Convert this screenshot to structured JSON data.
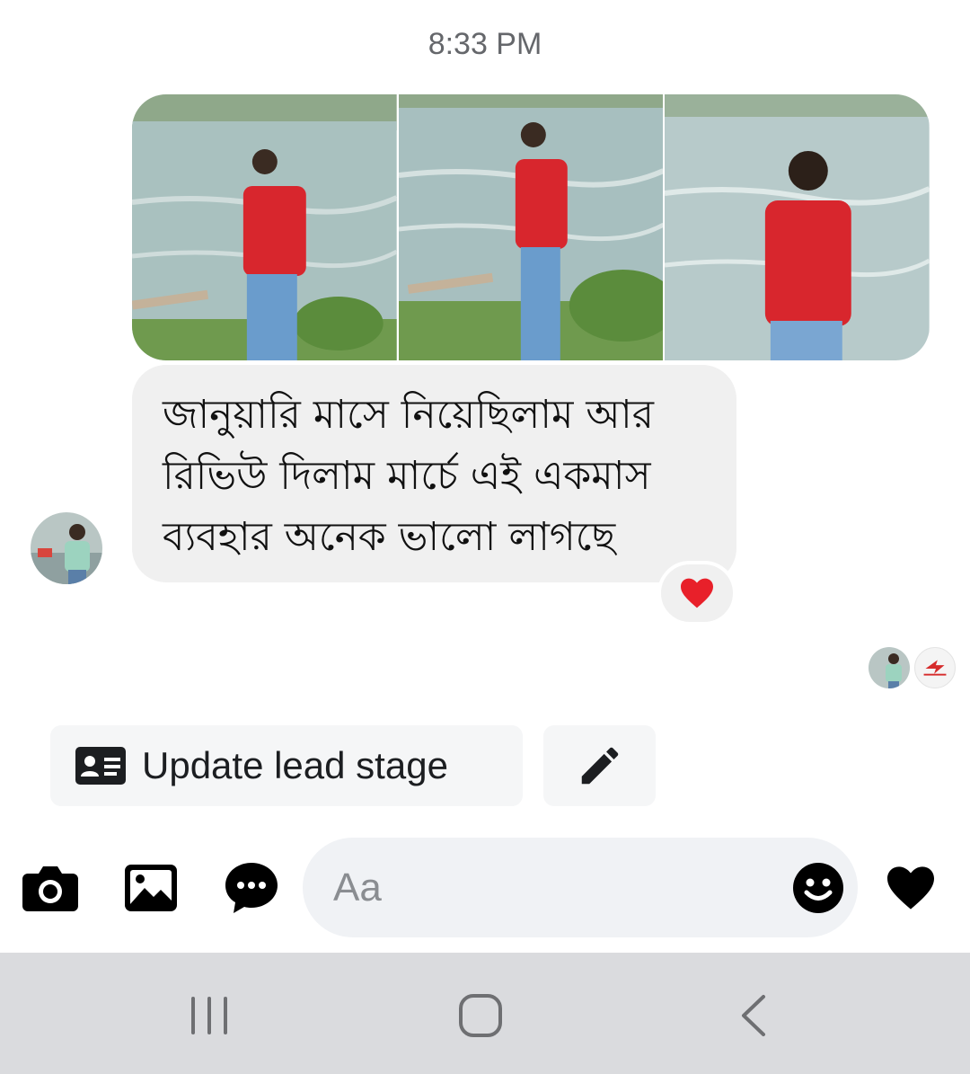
{
  "conversation": {
    "timestamp": "8:33 PM",
    "photos": [
      {
        "alt": "photo-1"
      },
      {
        "alt": "photo-2"
      },
      {
        "alt": "photo-3"
      }
    ],
    "message_lines": [
      "জানুয়ারি মাসে নিয়েছিলাম আর",
      "রিভিউ দিলাম মার্চে এই একমাস",
      "ব্যবহার অনেক ভালো লাগছে"
    ],
    "reaction_icon": "red-heart-emoji"
  },
  "actions": {
    "lead_button_label": "Update lead stage",
    "lead_button_icon": "contact-card-icon",
    "edit_icon": "pencil-icon"
  },
  "composer": {
    "placeholder": "Aa",
    "icons": [
      "camera-icon",
      "gallery-icon",
      "chat-bubble-icon",
      "emoji-icon",
      "heart-icon"
    ]
  },
  "system_nav": {
    "icons": [
      "recent-apps-icon",
      "home-icon",
      "back-icon"
    ]
  },
  "colors": {
    "bubble": "#f0f0f0",
    "reaction": "#e8202a",
    "nav_bar": "#dadbde",
    "icon": "#000000"
  }
}
